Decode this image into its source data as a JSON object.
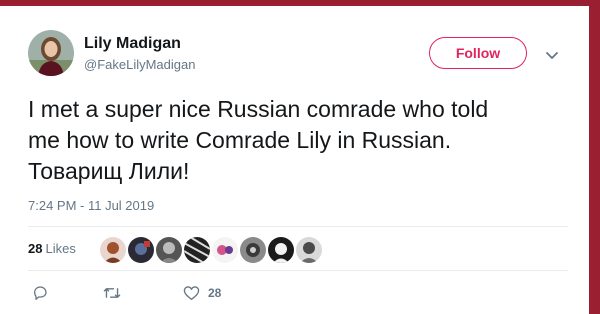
{
  "tweet": {
    "author_name": "Lily Madigan",
    "author_handle": "@FakeLilyMadigan",
    "follow_label": "Follow",
    "text_lines": [
      "I met a super nice Russian comrade who told",
      "me how to write Comrade Lily in Russian.",
      "Товарищ Лили!"
    ],
    "timestamp": "7:24 PM - 11 Jul 2019",
    "likes_count": "28",
    "likes_label": "Likes",
    "actions": {
      "reply_icon": "reply-icon",
      "retweet_icon": "retweet-icon",
      "like_icon": "heart-icon",
      "like_count": "28"
    }
  },
  "colors": {
    "accent": "#e0245e",
    "frame": "#9a1f30",
    "text": "#14171a",
    "muted": "#657786"
  }
}
